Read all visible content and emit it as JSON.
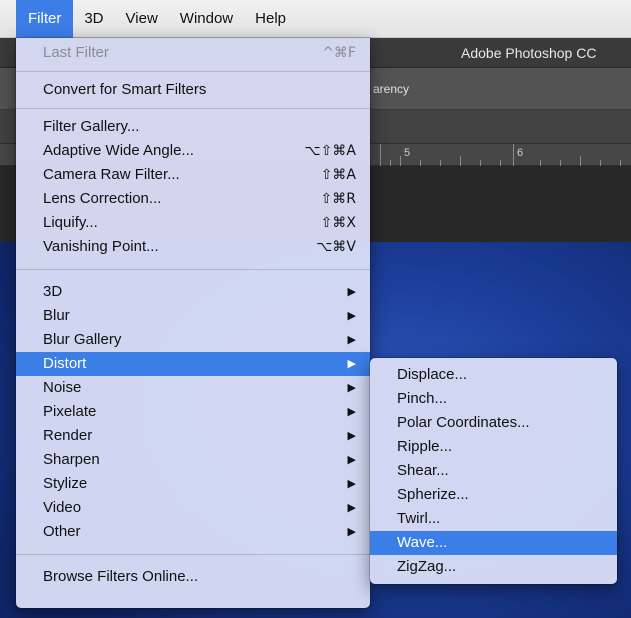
{
  "menubar": {
    "items": [
      "Filter",
      "3D",
      "View",
      "Window",
      "Help"
    ],
    "active_index": 0,
    "active_color": "#3c7ee8"
  },
  "app": {
    "title": "Adobe Photoshop CC",
    "options_text": "arency",
    "ruler_numbers": [
      "5",
      "6"
    ]
  },
  "filter_menu": {
    "last_filter": {
      "label": "Last Filter",
      "shortcut": "^⌘F",
      "enabled": false
    },
    "convert": "Convert for Smart Filters",
    "group1": [
      {
        "label": "Filter Gallery...",
        "shortcut": ""
      },
      {
        "label": "Adaptive Wide Angle...",
        "shortcut": "⌥⇧⌘A"
      },
      {
        "label": "Camera Raw Filter...",
        "shortcut": "⇧⌘A"
      },
      {
        "label": "Lens Correction...",
        "shortcut": "⇧⌘R"
      },
      {
        "label": "Liquify...",
        "shortcut": "⇧⌘X"
      },
      {
        "label": "Vanishing Point...",
        "shortcut": "⌥⌘V"
      }
    ],
    "submenus": [
      "3D",
      "Blur",
      "Blur Gallery",
      "Distort",
      "Noise",
      "Pixelate",
      "Render",
      "Sharpen",
      "Stylize",
      "Video",
      "Other"
    ],
    "highlighted_submenu": "Distort",
    "submenu_arrow": "▶",
    "browse": "Browse Filters Online..."
  },
  "distort_menu": {
    "items": [
      "Displace...",
      "Pinch...",
      "Polar Coordinates...",
      "Ripple...",
      "Shear...",
      "Spherize...",
      "Twirl...",
      "Wave...",
      "ZigZag..."
    ],
    "highlighted": "Wave..."
  }
}
